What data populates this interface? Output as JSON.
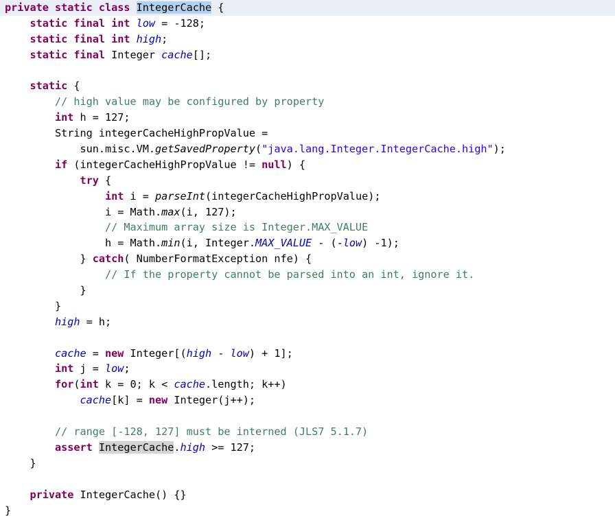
{
  "editor": {
    "language": "java",
    "file_class": "IntegerCache",
    "background_color": "#ffffff",
    "current_line_color": "#eaeef6",
    "selection_color": "#b4d2ee",
    "occurrence_color": "#d4d4d4",
    "colors": {
      "keyword": "#7f0055",
      "comment": "#3f7f5f",
      "string": "#2a00ff",
      "field": "#0000c0",
      "plain": "#000000"
    }
  },
  "lines": [
    {
      "current": true,
      "tokens": [
        {
          "t": "private",
          "c": "kw"
        },
        {
          "t": " ",
          "c": "plain"
        },
        {
          "t": "static",
          "c": "kw"
        },
        {
          "t": " ",
          "c": "plain"
        },
        {
          "t": "class",
          "c": "kw"
        },
        {
          "t": " ",
          "c": "plain"
        },
        {
          "t": "IntegerCache",
          "c": "plain",
          "hl": "sel"
        },
        {
          "t": " {",
          "c": "plain"
        }
      ]
    },
    {
      "current": false,
      "tokens": [
        {
          "t": "    ",
          "c": "plain"
        },
        {
          "t": "static",
          "c": "kw"
        },
        {
          "t": " ",
          "c": "plain"
        },
        {
          "t": "final",
          "c": "kw"
        },
        {
          "t": " ",
          "c": "plain"
        },
        {
          "t": "int",
          "c": "kw"
        },
        {
          "t": " ",
          "c": "plain"
        },
        {
          "t": "low",
          "c": "field"
        },
        {
          "t": " = -128;",
          "c": "plain"
        }
      ]
    },
    {
      "current": false,
      "tokens": [
        {
          "t": "    ",
          "c": "plain"
        },
        {
          "t": "static",
          "c": "kw"
        },
        {
          "t": " ",
          "c": "plain"
        },
        {
          "t": "final",
          "c": "kw"
        },
        {
          "t": " ",
          "c": "plain"
        },
        {
          "t": "int",
          "c": "kw"
        },
        {
          "t": " ",
          "c": "plain"
        },
        {
          "t": "high",
          "c": "field"
        },
        {
          "t": ";",
          "c": "plain"
        }
      ]
    },
    {
      "current": false,
      "tokens": [
        {
          "t": "    ",
          "c": "plain"
        },
        {
          "t": "static",
          "c": "kw"
        },
        {
          "t": " ",
          "c": "plain"
        },
        {
          "t": "final",
          "c": "kw"
        },
        {
          "t": " Integer ",
          "c": "plain"
        },
        {
          "t": "cache",
          "c": "field"
        },
        {
          "t": "[];",
          "c": "plain"
        }
      ]
    },
    {
      "current": false,
      "tokens": []
    },
    {
      "current": false,
      "tokens": [
        {
          "t": "    ",
          "c": "plain"
        },
        {
          "t": "static",
          "c": "kw"
        },
        {
          "t": " {",
          "c": "plain"
        }
      ]
    },
    {
      "current": false,
      "tokens": [
        {
          "t": "        ",
          "c": "plain"
        },
        {
          "t": "// high value may be configured by property",
          "c": "comment"
        }
      ]
    },
    {
      "current": false,
      "tokens": [
        {
          "t": "        ",
          "c": "plain"
        },
        {
          "t": "int",
          "c": "kw"
        },
        {
          "t": " h = 127;",
          "c": "plain"
        }
      ]
    },
    {
      "current": false,
      "tokens": [
        {
          "t": "        String integerCacheHighPropValue =",
          "c": "plain"
        }
      ]
    },
    {
      "current": false,
      "tokens": [
        {
          "t": "            sun.misc.VM.",
          "c": "plain"
        },
        {
          "t": "getSavedProperty",
          "c": "method"
        },
        {
          "t": "(",
          "c": "plain"
        },
        {
          "t": "\"java.lang.Integer.IntegerCache.high\"",
          "c": "string"
        },
        {
          "t": ");",
          "c": "plain"
        }
      ]
    },
    {
      "current": false,
      "tokens": [
        {
          "t": "        ",
          "c": "plain"
        },
        {
          "t": "if",
          "c": "kw"
        },
        {
          "t": " (integerCacheHighPropValue != ",
          "c": "plain"
        },
        {
          "t": "null",
          "c": "kw"
        },
        {
          "t": ") {",
          "c": "plain"
        }
      ]
    },
    {
      "current": false,
      "tokens": [
        {
          "t": "            ",
          "c": "plain"
        },
        {
          "t": "try",
          "c": "kw"
        },
        {
          "t": " {",
          "c": "plain"
        }
      ]
    },
    {
      "current": false,
      "tokens": [
        {
          "t": "                ",
          "c": "plain"
        },
        {
          "t": "int",
          "c": "kw"
        },
        {
          "t": " i = ",
          "c": "plain"
        },
        {
          "t": "parseInt",
          "c": "method"
        },
        {
          "t": "(integerCacheHighPropValue);",
          "c": "plain"
        }
      ]
    },
    {
      "current": false,
      "tokens": [
        {
          "t": "                i = Math.",
          "c": "plain"
        },
        {
          "t": "max",
          "c": "method"
        },
        {
          "t": "(i, 127);",
          "c": "plain"
        }
      ]
    },
    {
      "current": false,
      "tokens": [
        {
          "t": "                ",
          "c": "plain"
        },
        {
          "t": "// Maximum array size is Integer.MAX_VALUE",
          "c": "comment"
        }
      ]
    },
    {
      "current": false,
      "tokens": [
        {
          "t": "                h = Math.",
          "c": "plain"
        },
        {
          "t": "min",
          "c": "method"
        },
        {
          "t": "(i, Integer.",
          "c": "plain"
        },
        {
          "t": "MAX_VALUE",
          "c": "field"
        },
        {
          "t": " - (-",
          "c": "plain"
        },
        {
          "t": "low",
          "c": "field"
        },
        {
          "t": ") -1);",
          "c": "plain"
        }
      ]
    },
    {
      "current": false,
      "tokens": [
        {
          "t": "            } ",
          "c": "plain"
        },
        {
          "t": "catch",
          "c": "kw"
        },
        {
          "t": "( NumberFormatException nfe) {",
          "c": "plain"
        }
      ]
    },
    {
      "current": false,
      "tokens": [
        {
          "t": "                ",
          "c": "plain"
        },
        {
          "t": "// If the property cannot be parsed into an int, ignore it.",
          "c": "comment"
        }
      ]
    },
    {
      "current": false,
      "tokens": [
        {
          "t": "            }",
          "c": "plain"
        }
      ]
    },
    {
      "current": false,
      "tokens": [
        {
          "t": "        }",
          "c": "plain"
        }
      ]
    },
    {
      "current": false,
      "tokens": [
        {
          "t": "        ",
          "c": "plain"
        },
        {
          "t": "high",
          "c": "field"
        },
        {
          "t": " = h;",
          "c": "plain"
        }
      ]
    },
    {
      "current": false,
      "tokens": []
    },
    {
      "current": false,
      "tokens": [
        {
          "t": "        ",
          "c": "plain"
        },
        {
          "t": "cache",
          "c": "field"
        },
        {
          "t": " = ",
          "c": "plain"
        },
        {
          "t": "new",
          "c": "kw"
        },
        {
          "t": " Integer[(",
          "c": "plain"
        },
        {
          "t": "high",
          "c": "field"
        },
        {
          "t": " - ",
          "c": "plain"
        },
        {
          "t": "low",
          "c": "field"
        },
        {
          "t": ") + 1];",
          "c": "plain"
        }
      ]
    },
    {
      "current": false,
      "tokens": [
        {
          "t": "        ",
          "c": "plain"
        },
        {
          "t": "int",
          "c": "kw"
        },
        {
          "t": " j = ",
          "c": "plain"
        },
        {
          "t": "low",
          "c": "field"
        },
        {
          "t": ";",
          "c": "plain"
        }
      ]
    },
    {
      "current": false,
      "tokens": [
        {
          "t": "        ",
          "c": "plain"
        },
        {
          "t": "for",
          "c": "kw"
        },
        {
          "t": "(",
          "c": "plain"
        },
        {
          "t": "int",
          "c": "kw"
        },
        {
          "t": " k = 0; k < ",
          "c": "plain"
        },
        {
          "t": "cache",
          "c": "field"
        },
        {
          "t": ".length; k++)",
          "c": "plain"
        }
      ]
    },
    {
      "current": false,
      "tokens": [
        {
          "t": "            ",
          "c": "plain"
        },
        {
          "t": "cache",
          "c": "field"
        },
        {
          "t": "[k] = ",
          "c": "plain"
        },
        {
          "t": "new",
          "c": "kw"
        },
        {
          "t": " Integer(j++);",
          "c": "plain"
        }
      ]
    },
    {
      "current": false,
      "tokens": []
    },
    {
      "current": false,
      "tokens": [
        {
          "t": "        ",
          "c": "plain"
        },
        {
          "t": "// range [-128, 127] must be interned (JLS7 5.1.7)",
          "c": "comment"
        }
      ]
    },
    {
      "current": false,
      "tokens": [
        {
          "t": "        ",
          "c": "plain"
        },
        {
          "t": "assert",
          "c": "kw"
        },
        {
          "t": " ",
          "c": "plain"
        },
        {
          "t": "IntegerCache",
          "c": "plain",
          "hl": "occ"
        },
        {
          "t": ".",
          "c": "plain"
        },
        {
          "t": "high",
          "c": "field"
        },
        {
          "t": " >= 127;",
          "c": "plain"
        }
      ]
    },
    {
      "current": false,
      "tokens": [
        {
          "t": "    }",
          "c": "plain"
        }
      ]
    },
    {
      "current": false,
      "tokens": []
    },
    {
      "current": false,
      "tokens": [
        {
          "t": "    ",
          "c": "plain"
        },
        {
          "t": "private",
          "c": "kw"
        },
        {
          "t": " IntegerCache() {}",
          "c": "plain"
        }
      ]
    },
    {
      "current": false,
      "tokens": [
        {
          "t": "}",
          "c": "plain"
        }
      ]
    }
  ]
}
